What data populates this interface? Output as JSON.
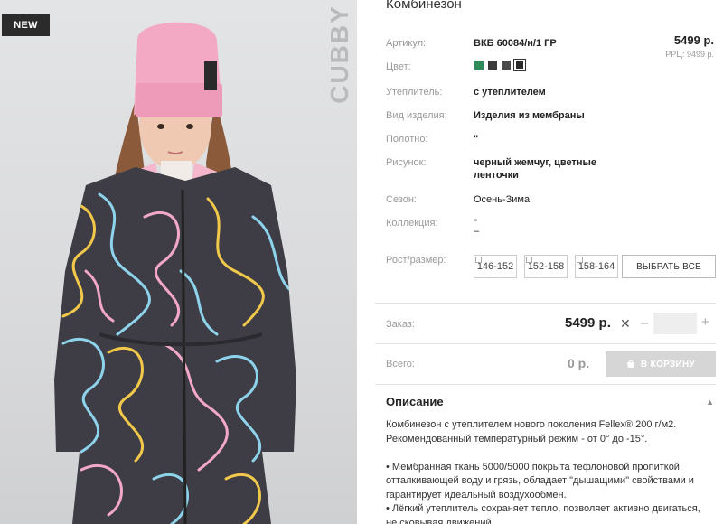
{
  "badge": "NEW",
  "brand_text": "CUBBY",
  "product": {
    "title": "Комбинезон",
    "price": "5499 р.",
    "rrc": "РРЦ: 9499 р.",
    "attrs": [
      {
        "label": "Артикул:",
        "value": "ВКБ 60084/н/1 ГР",
        "bold": true
      },
      {
        "label": "Цвет:",
        "value": ""
      },
      {
        "label": "Утеплитель:",
        "value": "с утеплителем",
        "bold": true
      },
      {
        "label": "Вид изделия:",
        "value": "Изделия из мембраны",
        "bold": true
      },
      {
        "label": "Полотно:",
        "value": "\"",
        "bold": true
      },
      {
        "label": "Рисунок:",
        "value": "черный жемчуг, цветные",
        "value2": "ленточки",
        "bold": true
      },
      {
        "label": "Сезон:",
        "value": "Осень-Зима",
        "bold": false
      },
      {
        "label": "Коллекция:",
        "value": "\"",
        "value2": "–",
        "bold": false
      },
      {
        "label": "Рост/размер:",
        "value": ""
      }
    ],
    "colors": [
      "#2e8b57",
      "#3a3a3a",
      "#4a4a4a",
      "#2a2a2a"
    ],
    "sizes": [
      "146-152",
      "152-158",
      "158-164"
    ],
    "select_all": "ВЫБРАТЬ ВСЕ"
  },
  "order": {
    "label": "Заказ:",
    "price": "5499 р.",
    "qty_value": "",
    "total_label": "Всего:",
    "total_value": "0 р.",
    "cart_button": "В КОРЗИНУ"
  },
  "description": {
    "heading": "Описание",
    "p1": "Комбинезон с утеплителем нового поколения Fellex® 200 г/м2. Рекомендованный температурный режим - от 0° до -15°.",
    "p2": "• Мембранная ткань 5000/5000 покрыта тефлоновой пропиткой, отталкивающей воду и грязь, обладает \"дышащими\" свойствами и гарантирует идеальный воздухообмен.",
    "p3": "• Лёгкий утеплитель сохраняет тепло, позволяет активно двигаться, не сковывая движений.."
  }
}
